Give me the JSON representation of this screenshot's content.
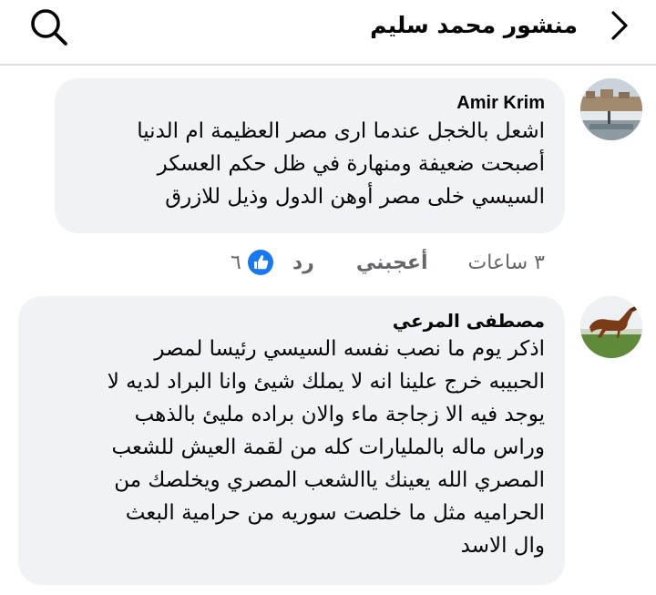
{
  "header": {
    "title": "منشور محمد سليم"
  },
  "comments": [
    {
      "author": "Amir Krim",
      "lines": [
        "اشعل بالخجل عندما ارى مصر العظيمة ام الدنيا",
        "أصبحت ضعيفة ومنهارة في ظل حكم العسكر",
        "السيسي خلى مصر أوهن الدول وذيل للازرق"
      ],
      "time": "٣ ساعات",
      "like_label": "أعجبني",
      "reply_label": "رد",
      "like_count": "٦"
    },
    {
      "author": "مصطفى المرعي",
      "lines": [
        "اذكر يوم ما نصب نفسه السيسي رئيسا لمصر",
        "الحبيبه خرج علينا انه لا يملك شيئ وانا البراد لديه لا",
        "يوجد فيه الا زجاجة ماء والان براده مليئ بالذهب",
        "وراس ماله بالمليارات كله من لقمة العيش للشعب",
        "المصري الله يعينك ياالشعب المصري ويخلصك من",
        "الحراميه مثل ما خلصت سوريه من حرامية البعث",
        "وال الاسد"
      ]
    }
  ],
  "colors": {
    "bubble_bg": "#f0f2f5",
    "secondary_text": "#65676b",
    "like_blue": "#1877f2",
    "divider": "#dcdde1"
  },
  "icons": {
    "back": "chevron-left-icon",
    "search": "search-icon",
    "like_reaction": "thumbs-up-icon"
  }
}
